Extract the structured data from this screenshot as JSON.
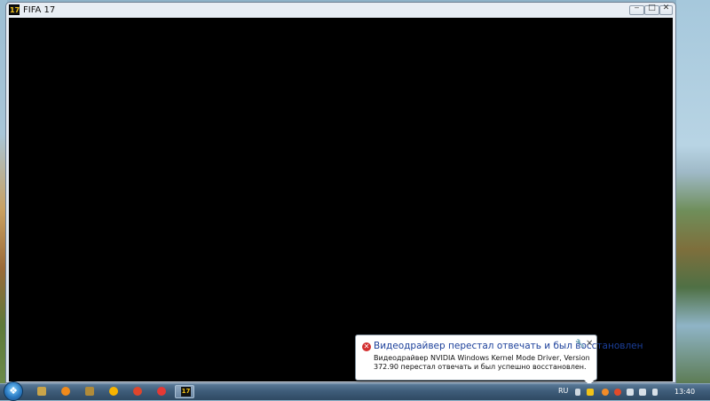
{
  "window": {
    "title": "FIFA 17",
    "app_icon_text": "17",
    "minimize": "‒",
    "maximize": "□",
    "close": "✕"
  },
  "notification": {
    "title": "Видеодрайвер перестал отвечать и был восстановлен",
    "body": "Видеодрайвер NVIDIA Windows Kernel Mode Driver, Version 372.90  перестал отвечать и был успешно восстановлен.",
    "error_glyph": "✕",
    "options_glyph": "🔧",
    "close_glyph": "✕"
  },
  "taskbar": {
    "start_glyph": "❖",
    "pinned": [
      {
        "name": "explorer",
        "color": "#c9a44a"
      },
      {
        "name": "media-player",
        "color": "#f08a1c"
      },
      {
        "name": "tool",
        "color": "#b08b3a"
      },
      {
        "name": "origin",
        "color": "#f7b300"
      },
      {
        "name": "app-red",
        "color": "#e0452c"
      },
      {
        "name": "yandex-browser",
        "color": "#e53935"
      }
    ],
    "active_task_text": "17",
    "language": "RU",
    "clock": "13:40"
  },
  "colors": {
    "title_blue": "#1b3f9a",
    "error_red": "#d32f2f",
    "taskbar": "#3e5c79"
  }
}
